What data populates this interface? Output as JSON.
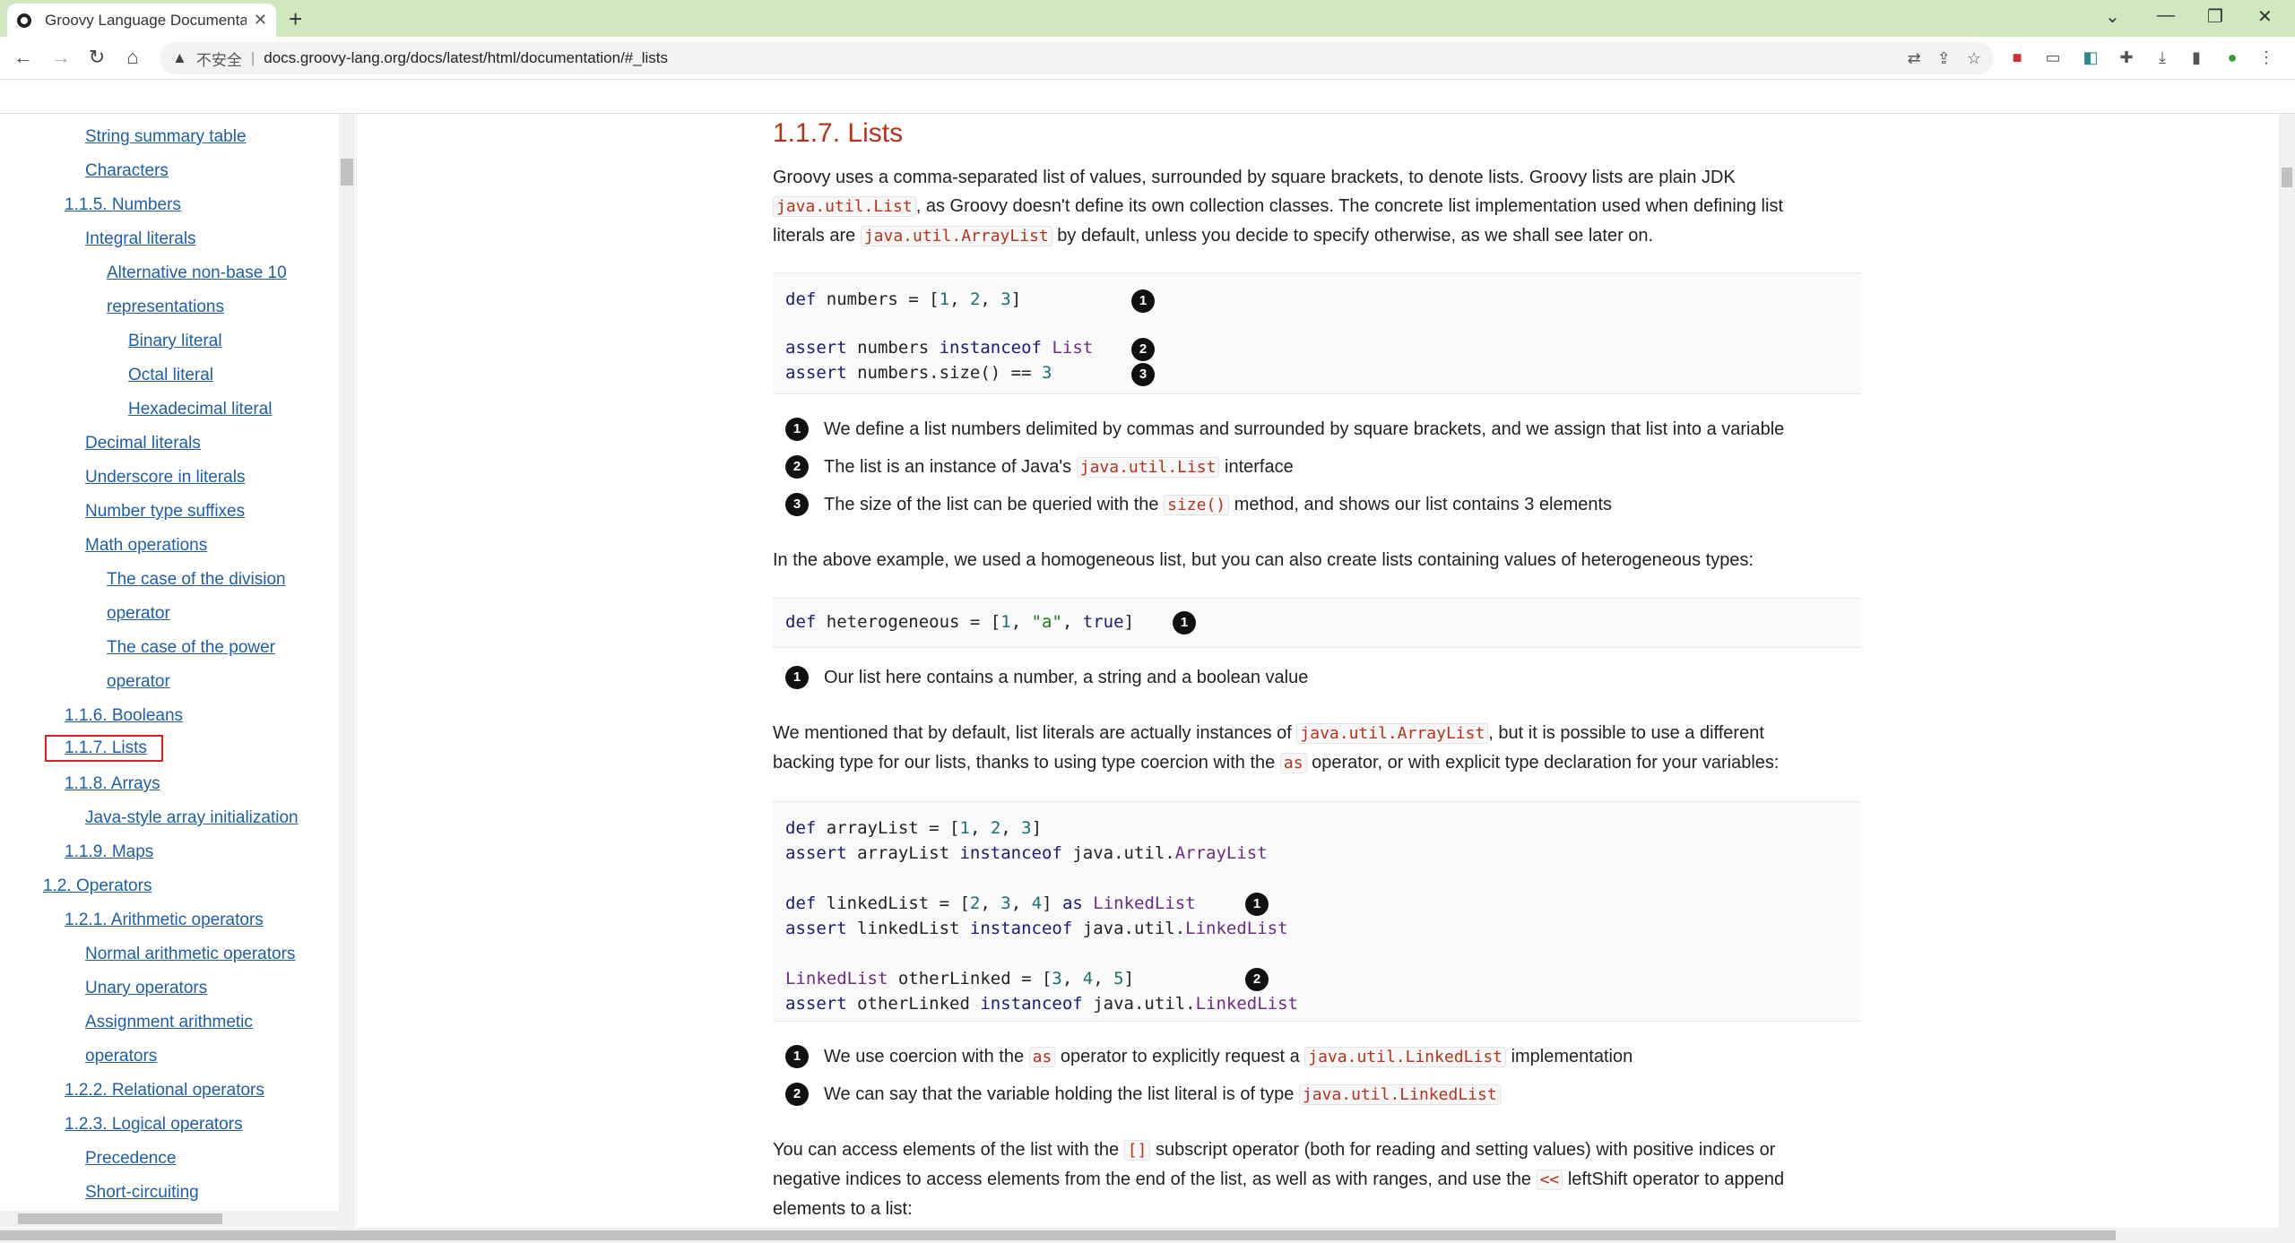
{
  "browser": {
    "tab_title": "Groovy Language Documentati",
    "address_insecure": "不安全",
    "address_url": "docs.groovy-lang.org/docs/latest/html/documentation/#_lists"
  },
  "toc": [
    {
      "label": "String summary table",
      "level": 2
    },
    {
      "label": "Characters",
      "level": 2
    },
    {
      "label": "1.1.5. Numbers",
      "level": 1
    },
    {
      "label": "Integral literals",
      "level": 2
    },
    {
      "label": "Alternative non-base 10",
      "level": 3
    },
    {
      "label": "representations",
      "level": 3
    },
    {
      "label": "Binary literal",
      "level": 4
    },
    {
      "label": "Octal literal",
      "level": 4
    },
    {
      "label": "Hexadecimal literal",
      "level": 4
    },
    {
      "label": "Decimal literals",
      "level": 2
    },
    {
      "label": "Underscore in literals",
      "level": 2
    },
    {
      "label": "Number type suffixes",
      "level": 2
    },
    {
      "label": "Math operations",
      "level": 2
    },
    {
      "label": "The case of the division",
      "level": 3
    },
    {
      "label": "operator",
      "level": 3
    },
    {
      "label": "The case of the power",
      "level": 3
    },
    {
      "label": "operator",
      "level": 3
    },
    {
      "label": "1.1.6. Booleans",
      "level": 1
    },
    {
      "label": "1.1.7. Lists",
      "level": 1,
      "selected": true
    },
    {
      "label": "1.1.8. Arrays",
      "level": 1
    },
    {
      "label": "Java-style array initialization",
      "level": 2
    },
    {
      "label": "1.1.9. Maps",
      "level": 1
    },
    {
      "label": "1.2. Operators",
      "level": 0
    },
    {
      "label": "1.2.1. Arithmetic operators",
      "level": 1
    },
    {
      "label": "Normal arithmetic operators",
      "level": 2
    },
    {
      "label": "Unary operators",
      "level": 2
    },
    {
      "label": "Assignment arithmetic",
      "level": 2
    },
    {
      "label": "operators",
      "level": 2
    },
    {
      "label": "1.2.2. Relational operators",
      "level": 1
    },
    {
      "label": "1.2.3. Logical operators",
      "level": 1
    },
    {
      "label": "Precedence",
      "level": 2
    },
    {
      "label": "Short-circuiting",
      "level": 2
    }
  ],
  "content": {
    "heading": "1.1.7. Lists",
    "p1": {
      "a": "Groovy uses a comma-separated list of values, surrounded by square brackets, to denote lists. Groovy lists are plain JDK",
      "code1": "java.util.List",
      "b": ", as Groovy doesn't define its own collection classes. The concrete list implementation used when defining list",
      "c": "literals are",
      "code2": "java.util.ArrayList",
      "d": "by default, unless you decide to specify otherwise, as we shall see later on."
    },
    "callouts1": [
      {
        "n": "1",
        "text": "We define a list numbers delimited by commas and surrounded by square brackets, and we assign that list into a variable"
      },
      {
        "n": "2",
        "pre": "The list is an instance of Java's",
        "code": "java.util.List",
        "post": "interface"
      },
      {
        "n": "3",
        "pre": "The size of the list can be queried with the",
        "code": "size()",
        "post": "method, and shows our list contains 3 elements"
      }
    ],
    "p2": "In the above example, we used a homogeneous list, but you can also create lists containing values of heterogeneous types:",
    "callouts2": [
      {
        "n": "1",
        "text": "Our list here contains a number, a string and a boolean value"
      }
    ],
    "p3": {
      "a": "We mentioned that by default, list literals are actually instances of",
      "code1": "java.util.ArrayList",
      "b": ", but it is possible to use a different",
      "c": "backing type for our lists, thanks to using type coercion with the",
      "code2": "as",
      "d": "operator, or with explicit type declaration for your variables:"
    },
    "callouts3": [
      {
        "n": "1",
        "pre": "We use coercion with the",
        "code": "as",
        "mid": "operator to explicitly request a",
        "code2": "java.util.LinkedList",
        "post": "implementation"
      },
      {
        "n": "2",
        "pre": "We can say that the variable holding the list literal is of type",
        "code": "java.util.LinkedList"
      }
    ],
    "p4": {
      "a": "You can access elements of the list with the",
      "code1": "[]",
      "b": "subscript operator (both for reading and setting values) with positive indices or",
      "c": "negative indices to access elements from the end of the list, as well as with ranges, and use the",
      "code2": "<<",
      "d": "leftShift operator to append",
      "e": "elements to a list:"
    }
  }
}
